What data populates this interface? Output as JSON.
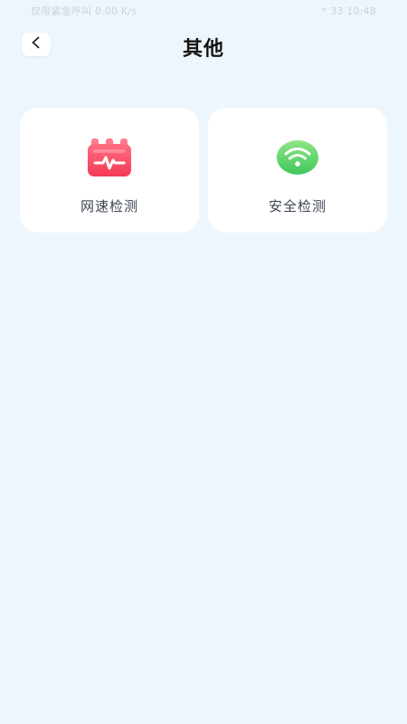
{
  "status_bar": {
    "left_text": "仅限紧急呼叫 0.00 K/s",
    "right_text": "* 33 10:48"
  },
  "header": {
    "title": "其他"
  },
  "cards": [
    {
      "label": "网速检测",
      "icon": "speed-test-icon",
      "accent": "#ff4f67"
    },
    {
      "label": "安全检测",
      "icon": "wifi-shield-icon",
      "accent": "#5cd46a"
    }
  ],
  "colors": {
    "background": "#eef6fd",
    "card": "#ffffff",
    "title": "#151515",
    "label": "#3b4452"
  }
}
